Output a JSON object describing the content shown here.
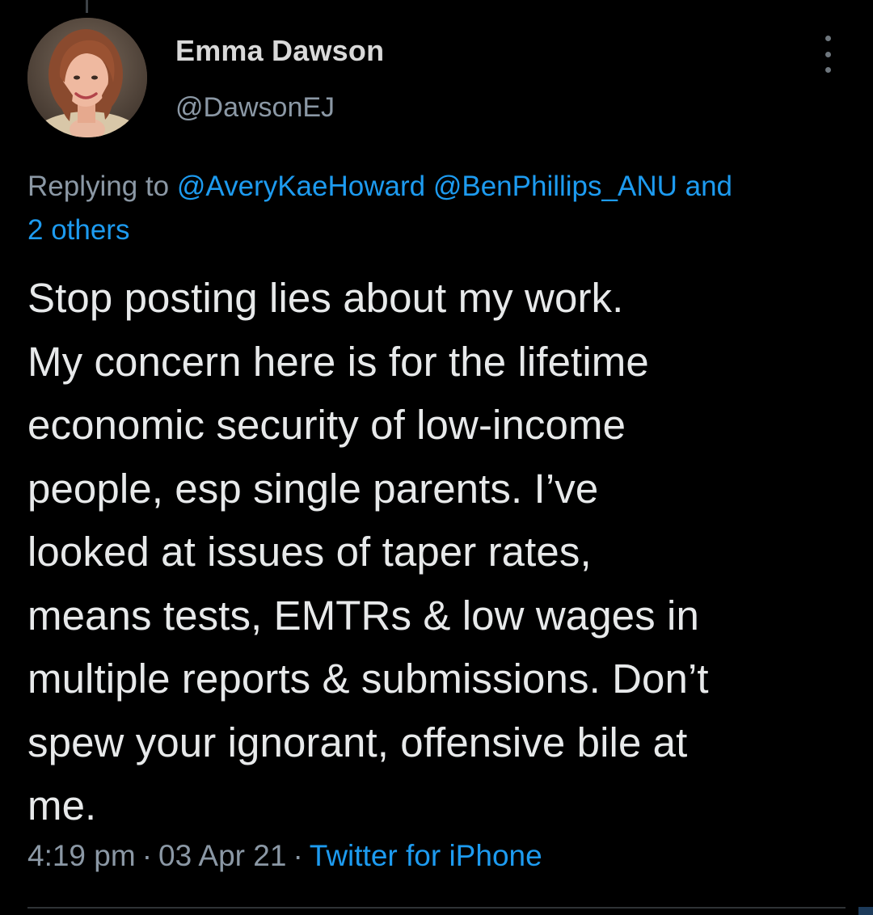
{
  "tweet": {
    "author": {
      "display_name": "Emma Dawson",
      "handle": "@DawsonEJ",
      "avatar_icon": "profile-photo"
    },
    "more_icon": "three-dots-vertical-icon",
    "replying_to": {
      "prefix": "Replying to",
      "mentions": [
        "@AveryKaeHoward",
        "@BenPhillips_ANU"
      ],
      "conjunction": "and",
      "others": "2 others"
    },
    "text_lines": [
      "Stop posting lies about my work.",
      "My concern here is for the lifetime",
      "economic security of low-income",
      "people, esp single parents. I’ve",
      "looked at issues of taper rates,",
      "means tests, EMTRs & low wages in",
      "multiple reports & submissions. Don’t",
      "spew your ignorant, offensive bile at",
      "me."
    ],
    "meta": {
      "time": "4:19 pm",
      "separator": "·",
      "date": "03 Apr 21",
      "source": "Twitter for iPhone"
    }
  },
  "colors": {
    "background": "#000000",
    "text": "#e7e9ea",
    "secondary": "#8b98a5",
    "link": "#1d9bf0",
    "divider": "#2f3336"
  }
}
